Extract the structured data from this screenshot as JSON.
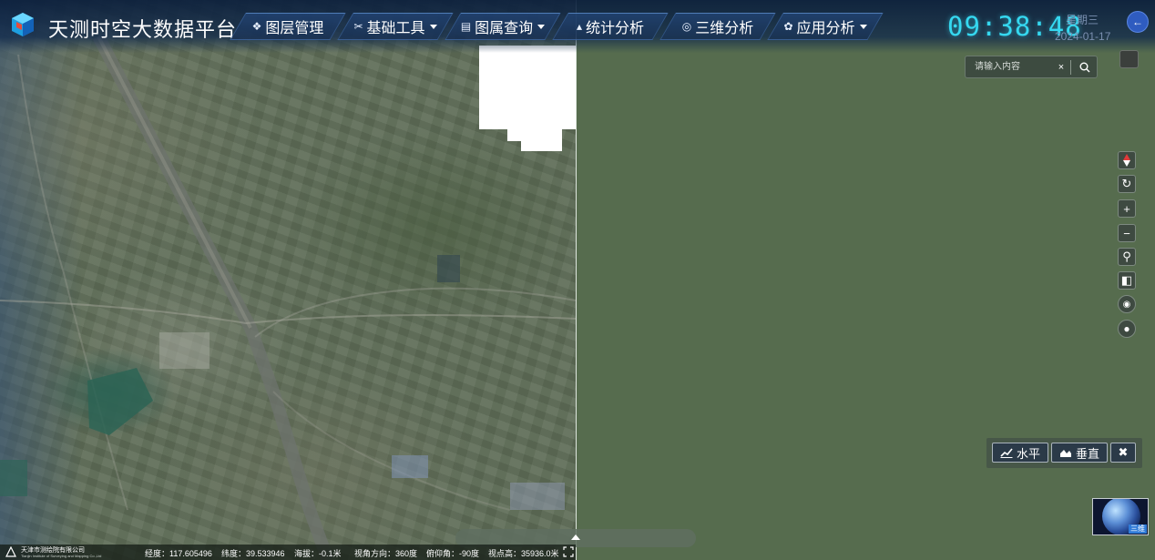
{
  "header": {
    "title": "天测时空大数据平台",
    "nav": [
      {
        "label": "图层管理",
        "icon": "layers-icon",
        "glyph": "❖",
        "dropdown": false
      },
      {
        "label": "基础工具",
        "icon": "tools-icon",
        "glyph": "✂",
        "dropdown": true
      },
      {
        "label": "图属查询",
        "icon": "query-icon",
        "glyph": "▤",
        "dropdown": true
      },
      {
        "label": "统计分析",
        "icon": "statistics-icon",
        "glyph": "▴",
        "dropdown": false
      },
      {
        "label": "三维分析",
        "icon": "cube-icon",
        "glyph": "◎",
        "dropdown": false
      },
      {
        "label": "应用分析",
        "icon": "apps-icon",
        "glyph": "✿",
        "dropdown": true
      }
    ],
    "clock": "09:38:48",
    "weekday": "星期三",
    "date": "2024-01-17"
  },
  "search": {
    "placeholder": "请输入内容",
    "value": "",
    "clear_glyph": "×"
  },
  "toolbar": [
    {
      "name": "compass-icon",
      "glyph": "▲"
    },
    {
      "name": "refresh-icon",
      "glyph": "↻"
    },
    {
      "name": "zoom-in-icon",
      "glyph": "+"
    },
    {
      "name": "zoom-out-icon",
      "glyph": "−"
    },
    {
      "name": "locate-user-icon",
      "glyph": "⚲"
    },
    {
      "name": "split-view-icon",
      "glyph": "◧"
    },
    {
      "name": "eye-icon",
      "glyph": "◉"
    },
    {
      "name": "globe-icon",
      "glyph": "●"
    }
  ],
  "profile_panel": {
    "horizontal_label": "水平",
    "vertical_label": "垂直",
    "close_glyph": "✖"
  },
  "globe_thumb": {
    "label": "三维"
  },
  "status_bar": {
    "brand": "天津市测绘院有限公司",
    "brand_sub": "Tianjin Institute of Surveying and Mapping Co.,Ltd",
    "longitude": "经度：117.605496",
    "latitude": "纬度：39.533946",
    "altitude": "海拔：-0.1米",
    "heading": "视角方向：360度",
    "pitch": "俯仰角：-90度",
    "view_height": "视点高：35936.0米"
  },
  "colors": {
    "clock": "#35d8f0",
    "accent": "#2f5cc0",
    "right_pane": "#566c4e"
  }
}
